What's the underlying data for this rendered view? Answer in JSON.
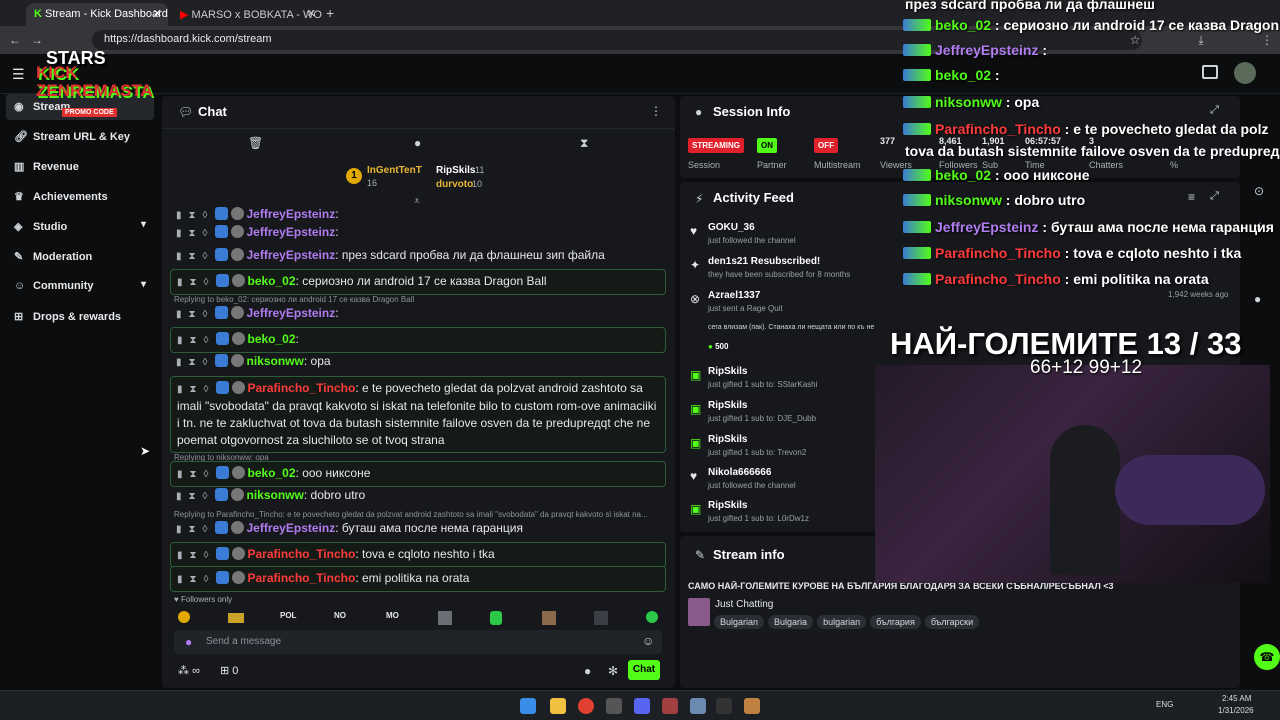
{
  "browser": {
    "tabs": [
      {
        "label": "Stream - Kick Dashboard",
        "active": true
      },
      {
        "label": "MARSO x BOBKATA - WOW",
        "active": false
      }
    ],
    "url": "https://dashboard.kick.com/stream"
  },
  "sidebar": {
    "items": [
      {
        "label": "Stream",
        "icon": "broadcast-icon"
      },
      {
        "label": "Stream URL & Key",
        "icon": "link-icon"
      },
      {
        "label": "Revenue",
        "icon": "chart-icon"
      },
      {
        "label": "Achievements",
        "icon": "trophy-icon"
      },
      {
        "label": "Studio",
        "icon": "layers-icon"
      },
      {
        "label": "Moderation",
        "icon": "wrench-icon"
      },
      {
        "label": "Community",
        "icon": "users-icon"
      },
      {
        "label": "Drops & rewards",
        "icon": "gift-icon"
      }
    ]
  },
  "chat": {
    "title": "Chat",
    "leaders": [
      {
        "name": "InGentTenT",
        "count": "16"
      },
      {
        "name": "RipSkils",
        "count": "11"
      },
      {
        "name": "durvoto",
        "count": "10"
      }
    ],
    "messages": [
      {
        "user": "JeffreyEpsteinz",
        "color": "#b07cf0",
        "text": "",
        "boxed": false,
        "reply": ""
      },
      {
        "user": "JeffreyEpsteinz",
        "color": "#b07cf0",
        "text": "",
        "boxed": false,
        "reply": ""
      },
      {
        "user": "JeffreyEpsteinz",
        "color": "#b07cf0",
        "text": "през sdcard пробва ли да флашнеш зип файла",
        "boxed": false,
        "reply": ""
      },
      {
        "user": "beko_02",
        "color": "#53fc18",
        "text": "сериозно ли android 17 се казва Dragon Ball",
        "boxed": true,
        "reply": ""
      },
      {
        "user": "JeffreyEpsteinz",
        "color": "#b07cf0",
        "text": "",
        "boxed": false,
        "reply": "Replying to beko_02: сериозно ли android 17 се казва Dragon Ball"
      },
      {
        "user": "beko_02",
        "color": "#53fc18",
        "text": "",
        "boxed": true,
        "reply": ""
      },
      {
        "user": "niksonww",
        "color": "#53fc18",
        "text": "ора",
        "boxed": false,
        "reply": ""
      },
      {
        "user": "Parafincho_Tincho",
        "color": "#ff3b3b",
        "text": "e te povecheto gledat da polzvat android zashtoto sa imali \"svobodata\" da pravqt kakvoto si iskat na telefonite bilo to custom rom-ove animaciiki i tn. ne te zakluchvat ot tova da butash sistemnite failove osven da te preduprедqt che ne poemat otgovornost za sluchiloto se ot tvoq strana",
        "boxed": true,
        "reply": ""
      },
      {
        "user": "beko_02",
        "color": "#53fc18",
        "text": "ооо никсоне",
        "boxed": true,
        "reply": "Replying to niksonww: ора"
      },
      {
        "user": "niksonww",
        "color": "#53fc18",
        "text": "dobro utro",
        "boxed": false,
        "reply": ""
      },
      {
        "user": "JeffreyEpsteinz",
        "color": "#b07cf0",
        "text": "буташ ама после нема гаранция",
        "boxed": false,
        "reply": "Replying to Parafincho_Tincho: e te povecheto gledat da polzvat android zashtoto sa imali \"svobodata\" da pravqt kakvoto si iskat na..."
      },
      {
        "user": "Parafincho_Tincho",
        "color": "#ff3b3b",
        "text": "tova e cqloto neshto i tka",
        "boxed": true,
        "reply": ""
      },
      {
        "user": "Parafincho_Tincho",
        "color": "#ff3b3b",
        "text": "emi politika na orata",
        "boxed": true,
        "reply": ""
      }
    ],
    "followers_only": "Followers only",
    "emote_labels": [
      "POL",
      "NO",
      "MO"
    ],
    "input_placeholder": "Send a message",
    "points": "∞",
    "count": "0",
    "send_label": "Chat"
  },
  "session": {
    "title": "Session Info",
    "stats": [
      {
        "value": "STREAMING",
        "label": "Session",
        "color": "#e0202a"
      },
      {
        "value": "ON",
        "label": "Partner",
        "color": "#53fc18"
      },
      {
        "value": "OFF",
        "label": "Multistream",
        "color": "#e0202a"
      },
      {
        "value": "377",
        "label": "Viewers"
      },
      {
        "value": "8,461",
        "label": "Followers"
      },
      {
        "value": "1,901",
        "label": "Sub"
      },
      {
        "value": "06:57:57",
        "label": "Time"
      },
      {
        "value": "3",
        "label": "Chatters"
      },
      {
        "value": "",
        "label": "%"
      }
    ]
  },
  "activity": {
    "title": "Activity Feed",
    "items": [
      {
        "name": "GOKU_36",
        "text": "just followed the channel",
        "icon": "heart-icon"
      },
      {
        "name": "den1s21 Resubscribed!",
        "text": "they have been subscribed for 8 months",
        "icon": "star-icon"
      },
      {
        "name": "Azrael1337",
        "text": "just sent a Rage Quit",
        "icon": "close-circle-icon",
        "note": "сега влизам (пак). Станаха ли нещата или по къ не",
        "amount": "500"
      },
      {
        "name": "RipSkils",
        "text": "just gifted 1 sub to: SStarKashi",
        "icon": "gift-icon"
      },
      {
        "name": "RipSkils",
        "text": "just gifted 1 sub to: DJE_Dubb",
        "icon": "gift-icon"
      },
      {
        "name": "RipSkils",
        "text": "just gifted 1 sub to: Trevon2",
        "icon": "gift-icon"
      },
      {
        "name": "Nikola666666",
        "text": "just followed the channel",
        "icon": "heart-icon"
      },
      {
        "name": "RipSkils",
        "text": "just gifted 1 sub to: L0rDw1z",
        "icon": "gift-icon"
      }
    ],
    "time_ago": "1,942 weeks ago"
  },
  "stream_info": {
    "title": "Stream info",
    "stream_title": "САМО НАЙ-ГОЛЕМИТЕ КУРОВЕ НА БЪЛГАРИЯ БЛАГОДАРЯ ЗА ВСЕКИ СЪБНАЛ/РЕСЪБНАЛ <3",
    "category": "Just Chatting",
    "tags": [
      "Bulgarian",
      "Bulgaria",
      "bulgarian",
      "българия",
      "български"
    ]
  },
  "overlay": {
    "logo_text": "KICK ZENREMASTA",
    "promo": "PROMO CODE",
    "stars": "STARS",
    "headline": "НАЙ-ГОЛЕМИТЕ 13 / 33",
    "subline": "66+12 99+12",
    "chat": [
      {
        "user": "",
        "text": "през sdcard пробва ли да флашнеш",
        "color": "#ffffff"
      },
      {
        "user": "beko_02",
        "text": "сериозно ли android 17 се казва Dragon",
        "color": "#53fc18"
      },
      {
        "user": "JeffreyEpsteinz",
        "text": "",
        "color": "#b07cf0"
      },
      {
        "user": "beko_02",
        "text": "",
        "color": "#53fc18"
      },
      {
        "user": "niksonww",
        "text": "ора",
        "color": "#53fc18"
      },
      {
        "user": "Parafincho_Tincho",
        "text": "e te povecheto gledat da polz",
        "color": "#ff3b3b"
      },
      {
        "user": "",
        "text": "tova da butash sistemnite failove osven da te preduprедqt c",
        "color": "#ffffff"
      },
      {
        "user": "beko_02",
        "text": "ооо никсоне",
        "color": "#53fc18"
      },
      {
        "user": "niksonww",
        "text": "dobro utro",
        "color": "#53fc18"
      },
      {
        "user": "JeffreyEpsteinz",
        "text": "буташ ама после нема гаранция",
        "color": "#b07cf0"
      },
      {
        "user": "Parafincho_Tincho",
        "text": "tova e cqloto neshto i tka",
        "color": "#ff3b3b"
      },
      {
        "user": "Parafincho_Tincho",
        "text": "emi politika na orata",
        "color": "#ff3b3b"
      }
    ]
  },
  "taskbar": {
    "time": "2:45 AM",
    "date": "1/31/2026",
    "lang": "ENG"
  },
  "colors": {
    "accent": "#53fc18",
    "panel": "#16181c",
    "bg": "#0b0d0f"
  }
}
